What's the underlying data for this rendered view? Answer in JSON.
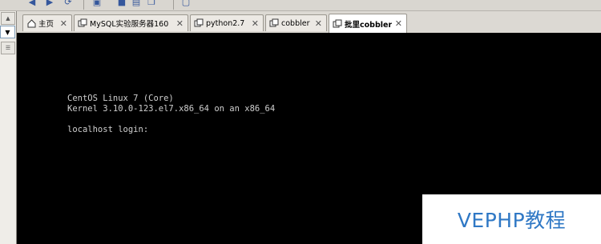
{
  "toolbar": {
    "icons": [
      "back-icon",
      "forward-icon",
      "refresh-icon",
      "window-icon",
      "save-icon",
      "print-icon",
      "copy-icon",
      "fullscreen-icon"
    ]
  },
  "tabs": [
    {
      "label": "主页",
      "icon": "home-icon",
      "close": "✕"
    },
    {
      "label": "MySQL实验服务器160",
      "icon": "vm-icon",
      "close": "✕"
    },
    {
      "label": "python2.7",
      "icon": "vm-icon",
      "close": "✕"
    },
    {
      "label": "cobbler",
      "icon": "vm-icon",
      "close": "✕"
    },
    {
      "label": "批里cobbler",
      "icon": "vm-icon",
      "close": "✕",
      "active": true
    }
  ],
  "console": {
    "line1": "CentOS Linux 7 (Core)",
    "line2": "Kernel 3.10.0-123.el7.x86_64 on an x86_64",
    "line3": "localhost login:"
  },
  "watermark": "VEPHP教程",
  "colors": {
    "console_bg": "#000000",
    "console_fg": "#cfcfcf",
    "watermark": "#2f78c5"
  }
}
